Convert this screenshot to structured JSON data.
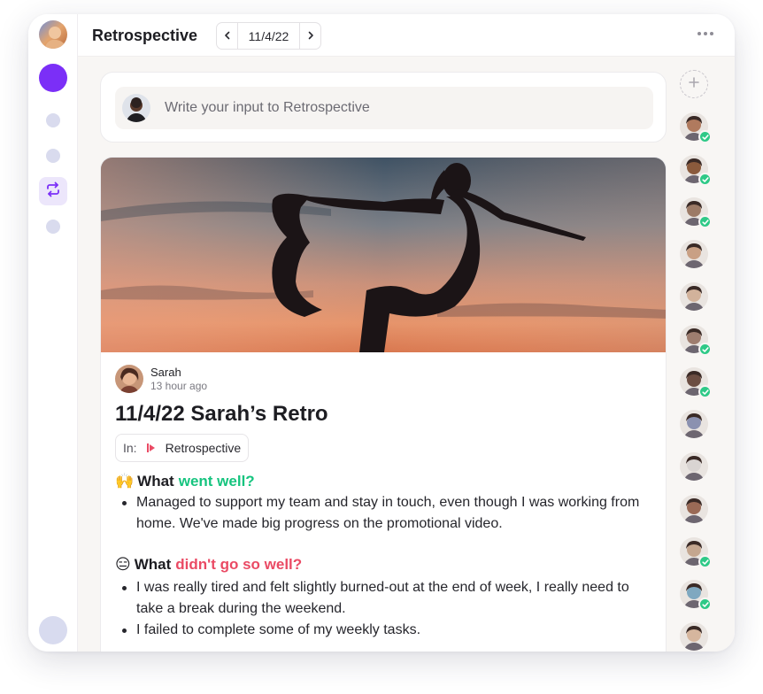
{
  "header": {
    "title": "Retrospective",
    "date": "11/4/22",
    "prev_icon": "chevron-left-icon",
    "next_icon": "chevron-right-icon",
    "more_icon": "more-horizontal-icon"
  },
  "rail": {
    "items": [
      "workspace-avatar",
      "purple-space",
      "nav-dot",
      "nav-dot",
      "retro-icon",
      "nav-dot",
      "user-avatar"
    ]
  },
  "composer": {
    "placeholder": "Write your input to Retrospective"
  },
  "post": {
    "author": "Sarah",
    "time": "13 hour ago",
    "title": "11/4/22 Sarah’s Retro",
    "in_label": "In:",
    "in_value": "Retrospective",
    "sections": [
      {
        "emoji": "🙌",
        "lead": "What",
        "highlight": "went well?",
        "items": [
          "Managed to support my team and stay in touch, even though I was working from home. We've made big progress on the promotional video."
        ]
      },
      {
        "emoji": "😑",
        "lead": "What",
        "highlight": "didn't go so well?",
        "items": [
          "I was really tired and felt slightly burned-out at the end of week, I really need to take a break during the weekend.",
          "I failed to complete some of my weekly tasks."
        ]
      }
    ]
  },
  "participants": {
    "add_icon": "plus-icon",
    "people": [
      {
        "checked": true,
        "skin": "#b07a5e"
      },
      {
        "checked": true,
        "skin": "#8a5a3c"
      },
      {
        "checked": true,
        "skin": "#9c7a66"
      },
      {
        "checked": false,
        "skin": "#c9a084"
      },
      {
        "checked": false,
        "skin": "#d2b29b"
      },
      {
        "checked": true,
        "skin": "#9e7d6f"
      },
      {
        "checked": true,
        "skin": "#6b4d42"
      },
      {
        "checked": false,
        "skin": "#8b91b0"
      },
      {
        "checked": false,
        "skin": "#d9d4d2"
      },
      {
        "checked": false,
        "skin": "#9a6a56"
      },
      {
        "checked": true,
        "skin": "#c4a68f"
      },
      {
        "checked": true,
        "skin": "#7fa8c0"
      },
      {
        "checked": false,
        "skin": "#d6b69e"
      }
    ]
  },
  "colors": {
    "accent": "#7b2ff7",
    "green": "#16c47f",
    "red": "#ea4a64",
    "check": "#2ec987"
  }
}
